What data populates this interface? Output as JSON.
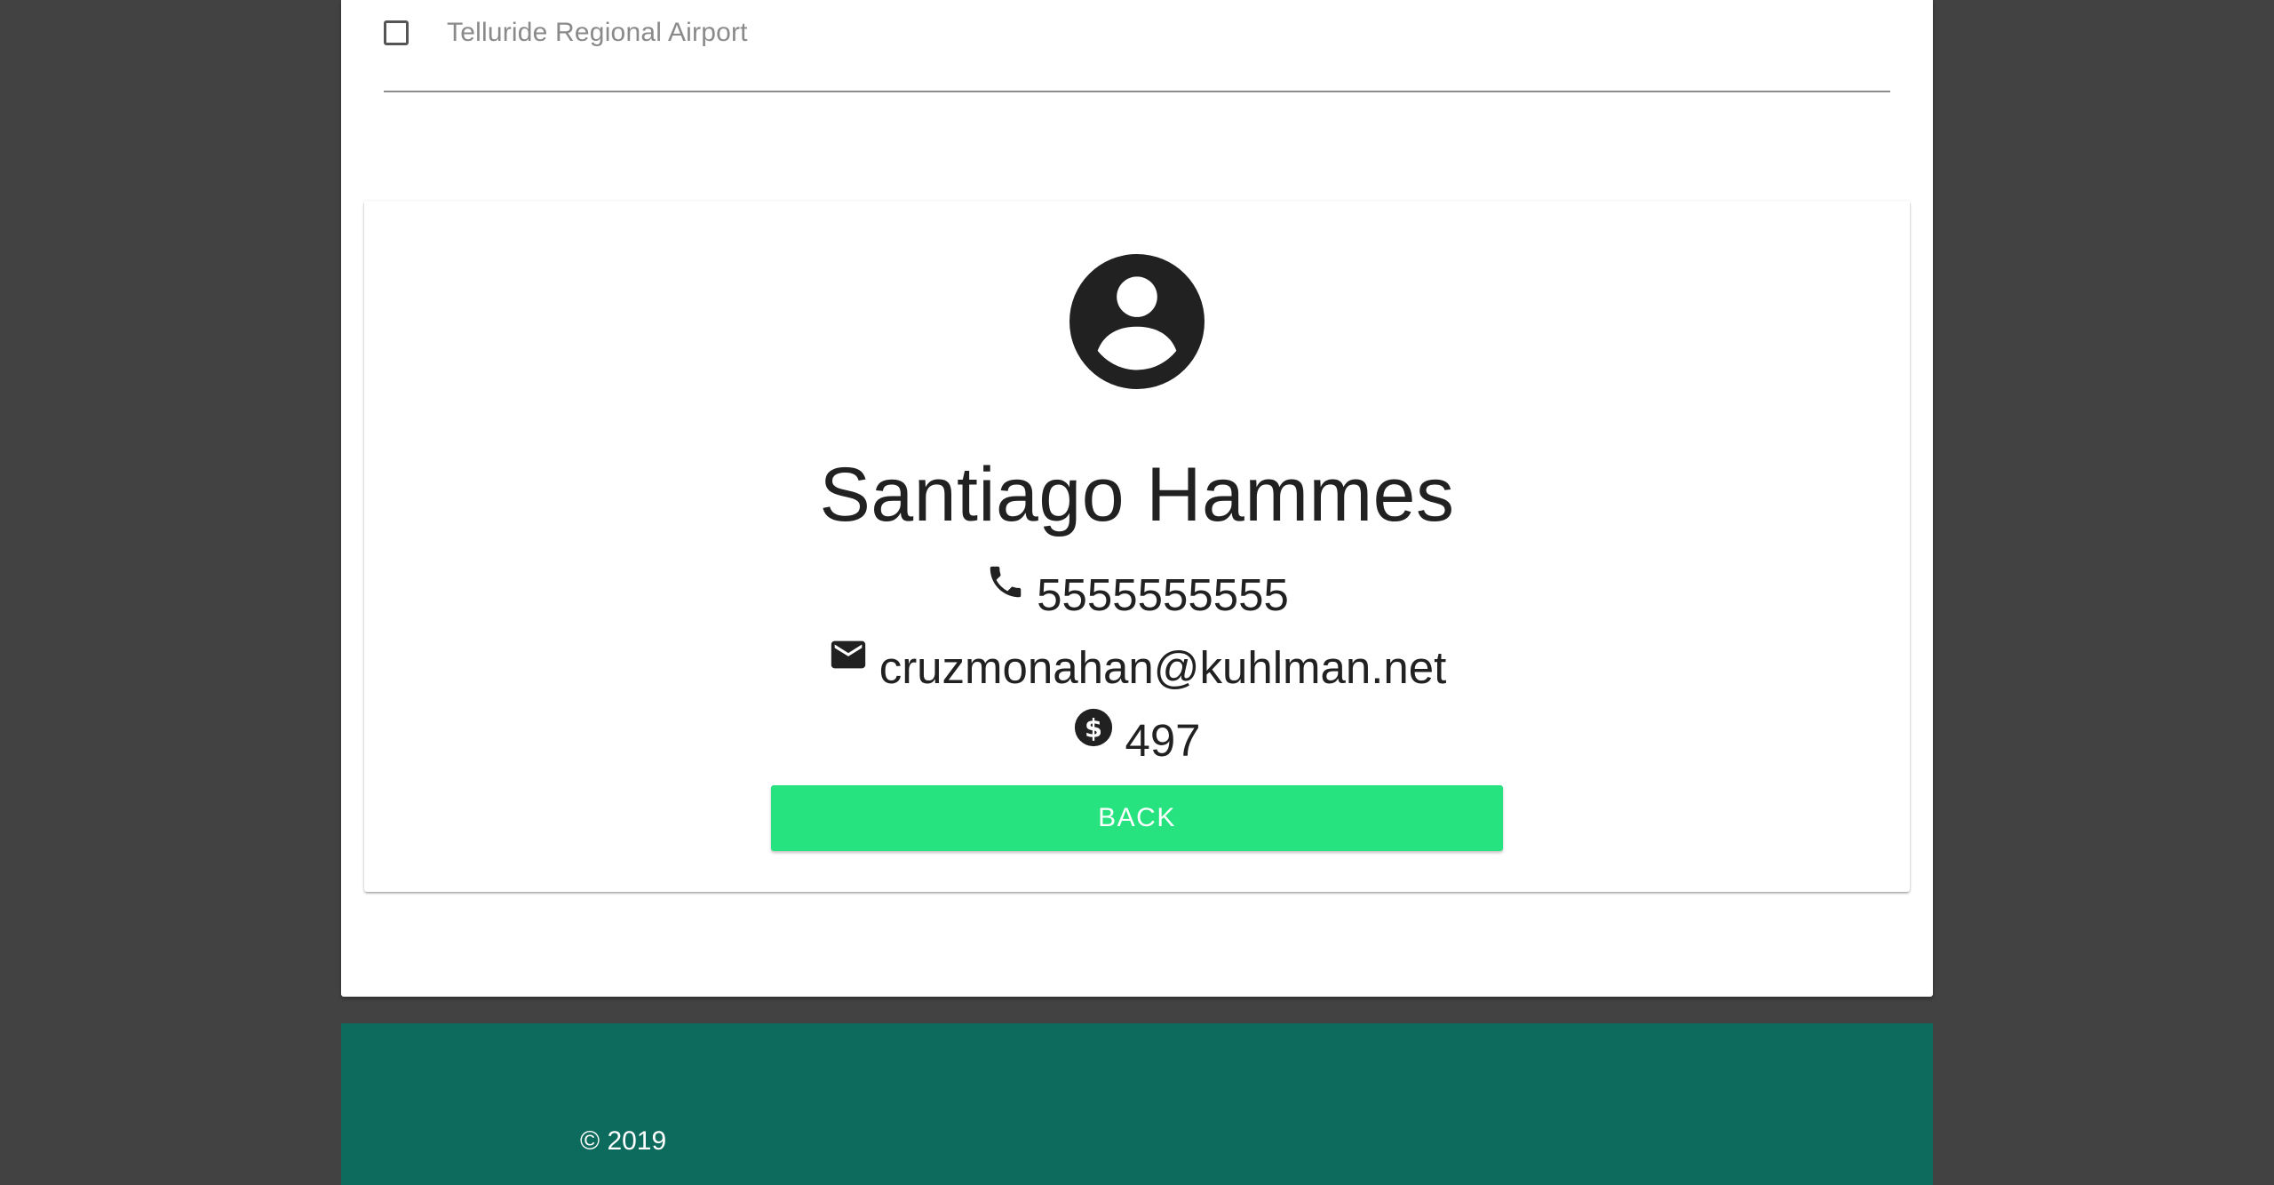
{
  "airport_filter": {
    "option_label": "Telluride Regional Airport",
    "checked": false
  },
  "profile": {
    "avatar_icon": "account-circle-icon",
    "name": "Santiago Hammes",
    "phone": {
      "icon": "phone-icon",
      "value": "5555555555"
    },
    "email": {
      "icon": "email-icon",
      "value": "cruzmonahan@kuhlman.net"
    },
    "balance": {
      "icon": "dollar-circle-icon",
      "value": "497"
    },
    "back_label": "BACK"
  },
  "footer": {
    "copyright": "© 2019"
  },
  "colors": {
    "background": "#424242",
    "card": "#ffffff",
    "button": "#26e37f",
    "footer": "#0d6b5d",
    "text": "#212121"
  }
}
